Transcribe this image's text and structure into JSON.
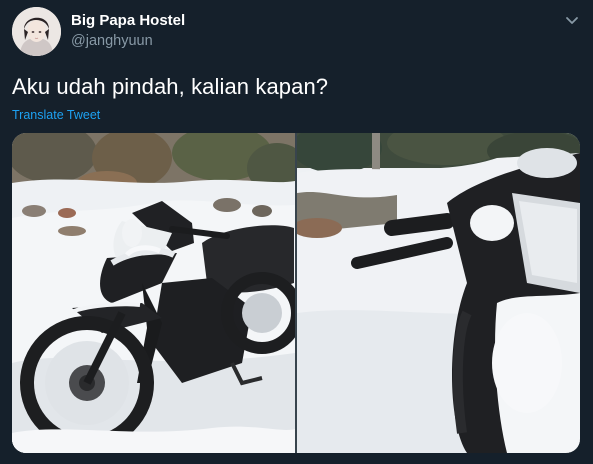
{
  "tweet": {
    "display_name": "Big Papa Hostel",
    "handle": "@janghyuun",
    "text": "Aku udah pindah, kalian kapan?",
    "translate_label": "Translate Tweet"
  },
  "icons": {
    "caret": "chevron-down-icon"
  },
  "colors": {
    "background": "#15202b",
    "primary_text": "#ffffff",
    "secondary_text": "#8899a6",
    "link": "#1da1f2"
  }
}
